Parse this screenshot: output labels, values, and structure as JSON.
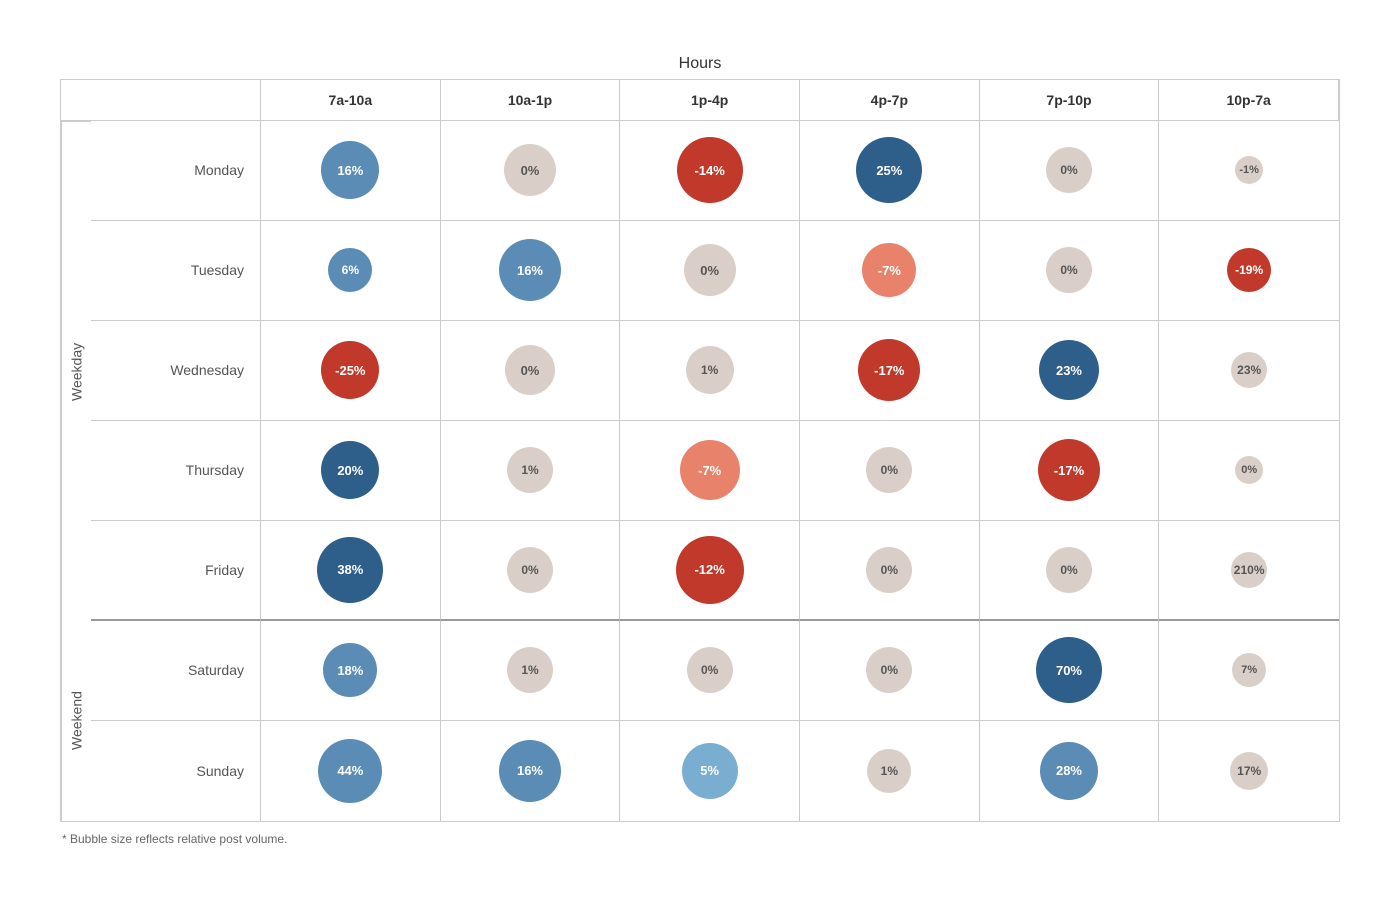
{
  "title": "Hours",
  "columns": [
    "7a-10a",
    "10a-1p",
    "1p-4p",
    "4p-7p",
    "7p-10p",
    "10p-7a"
  ],
  "weekday_label": "Weekday",
  "weekend_label": "Weekend",
  "footnote": "* Bubble size reflects relative post volume.",
  "rows": [
    {
      "day": "Monday",
      "group": "weekday",
      "cells": [
        {
          "value": "16%",
          "size": 58,
          "color": "blue-mid"
        },
        {
          "value": "0%",
          "size": 52,
          "color": "neutral"
        },
        {
          "value": "-14%",
          "size": 66,
          "color": "red-dark"
        },
        {
          "value": "25%",
          "size": 66,
          "color": "blue-dark"
        },
        {
          "value": "0%",
          "size": 46,
          "color": "neutral"
        },
        {
          "value": "-1%",
          "size": 28,
          "color": "neutral",
          "text_color": "#555"
        }
      ]
    },
    {
      "day": "Tuesday",
      "group": "weekday",
      "cells": [
        {
          "value": "6%",
          "size": 44,
          "color": "blue-mid"
        },
        {
          "value": "16%",
          "size": 62,
          "color": "blue-mid"
        },
        {
          "value": "0%",
          "size": 52,
          "color": "neutral"
        },
        {
          "value": "-7%",
          "size": 54,
          "color": "red-light"
        },
        {
          "value": "0%",
          "size": 46,
          "color": "neutral"
        },
        {
          "value": "-19%",
          "size": 44,
          "color": "red-dark"
        }
      ]
    },
    {
      "day": "Wednesday",
      "group": "weekday",
      "cells": [
        {
          "value": "-25%",
          "size": 58,
          "color": "red-dark"
        },
        {
          "value": "0%",
          "size": 50,
          "color": "neutral"
        },
        {
          "value": "1%",
          "size": 48,
          "color": "neutral"
        },
        {
          "value": "-17%",
          "size": 62,
          "color": "red-dark"
        },
        {
          "value": "23%",
          "size": 60,
          "color": "blue-dark"
        },
        {
          "value": "23%",
          "size": 36,
          "color": "neutral",
          "text_color": "#555"
        }
      ]
    },
    {
      "day": "Thursday",
      "group": "weekday",
      "cells": [
        {
          "value": "20%",
          "size": 58,
          "color": "blue-dark"
        },
        {
          "value": "1%",
          "size": 46,
          "color": "neutral"
        },
        {
          "value": "-7%",
          "size": 60,
          "color": "red-light"
        },
        {
          "value": "0%",
          "size": 46,
          "color": "neutral"
        },
        {
          "value": "-17%",
          "size": 62,
          "color": "red-dark"
        },
        {
          "value": "0%",
          "size": 28,
          "color": "neutral",
          "text_color": "#555"
        }
      ]
    },
    {
      "day": "Friday",
      "group": "weekday",
      "last": true,
      "cells": [
        {
          "value": "38%",
          "size": 66,
          "color": "blue-dark"
        },
        {
          "value": "0%",
          "size": 46,
          "color": "neutral"
        },
        {
          "value": "-12%",
          "size": 68,
          "color": "red-dark"
        },
        {
          "value": "0%",
          "size": 46,
          "color": "neutral"
        },
        {
          "value": "0%",
          "size": 46,
          "color": "neutral"
        },
        {
          "value": "210%",
          "size": 36,
          "color": "neutral",
          "text_color": "#555"
        }
      ]
    },
    {
      "day": "Saturday",
      "group": "weekend",
      "cells": [
        {
          "value": "18%",
          "size": 54,
          "color": "blue-mid"
        },
        {
          "value": "1%",
          "size": 46,
          "color": "neutral"
        },
        {
          "value": "0%",
          "size": 46,
          "color": "neutral"
        },
        {
          "value": "0%",
          "size": 46,
          "color": "neutral"
        },
        {
          "value": "70%",
          "size": 66,
          "color": "blue-dark"
        },
        {
          "value": "7%",
          "size": 34,
          "color": "neutral",
          "text_color": "#555"
        }
      ]
    },
    {
      "day": "Sunday",
      "group": "weekend",
      "last": true,
      "cells": [
        {
          "value": "44%",
          "size": 64,
          "color": "blue-mid"
        },
        {
          "value": "16%",
          "size": 62,
          "color": "blue-mid"
        },
        {
          "value": "5%",
          "size": 56,
          "color": "blue-light"
        },
        {
          "value": "1%",
          "size": 44,
          "color": "neutral"
        },
        {
          "value": "28%",
          "size": 58,
          "color": "blue-mid"
        },
        {
          "value": "17%",
          "size": 38,
          "color": "neutral",
          "text_color": "#555"
        }
      ]
    }
  ]
}
